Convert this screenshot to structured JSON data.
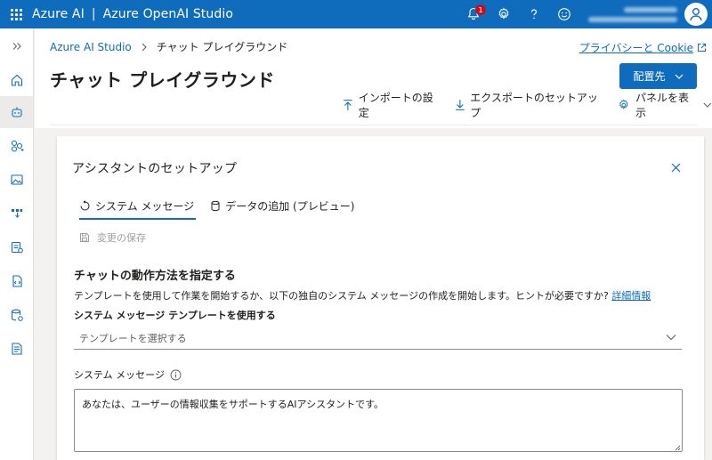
{
  "topbar": {
    "brand": "Azure AI",
    "separator": "|",
    "product": "Azure OpenAI Studio",
    "notification_count": "1",
    "colors": {
      "accent": "#0f6cbd",
      "badge": "#c50f1f"
    }
  },
  "rail": {
    "items": [
      {
        "icon": "expand-chevrons-icon"
      },
      {
        "icon": "home-icon"
      },
      {
        "icon": "chat-bot-icon",
        "active": true
      },
      {
        "icon": "models-icon"
      },
      {
        "icon": "images-icon"
      },
      {
        "icon": "deployments-icon"
      },
      {
        "icon": "data-files-icon"
      },
      {
        "icon": "code-icon"
      },
      {
        "icon": "quota-icon"
      },
      {
        "icon": "content-filters-icon"
      }
    ]
  },
  "breadcrumb": {
    "root": "Azure AI Studio",
    "current": "チャット プレイグラウンド"
  },
  "privacy_link": "プライバシーと Cookie",
  "page_title": "チャット プレイグラウンド",
  "deploy_button": "配置先",
  "toolbar": {
    "import": "インポートの設定",
    "export": "エクスポートのセットアップ",
    "panels": "パネルを表示"
  },
  "card": {
    "title": "アシスタントのセットアップ",
    "tabs": [
      {
        "label": "システム メッセージ",
        "active": true
      },
      {
        "label": "データの追加 (プレビュー)",
        "active": false
      }
    ],
    "save_label": "変更の保存",
    "heading": "チャットの動作方法を指定する",
    "description": "テンプレートを使用して作業を開始するか、以下の独自のシステム メッセージの作成を開始します。ヒントが必要ですか?",
    "learn_more": "詳細情報",
    "template_label": "システム メッセージ テンプレートを使用する",
    "template_placeholder": "テンプレートを選択する",
    "system_message_label": "システム メッセージ",
    "system_message_value": "あなたは、ユーザーの情報収集をサポートするAIアシスタントです。"
  }
}
